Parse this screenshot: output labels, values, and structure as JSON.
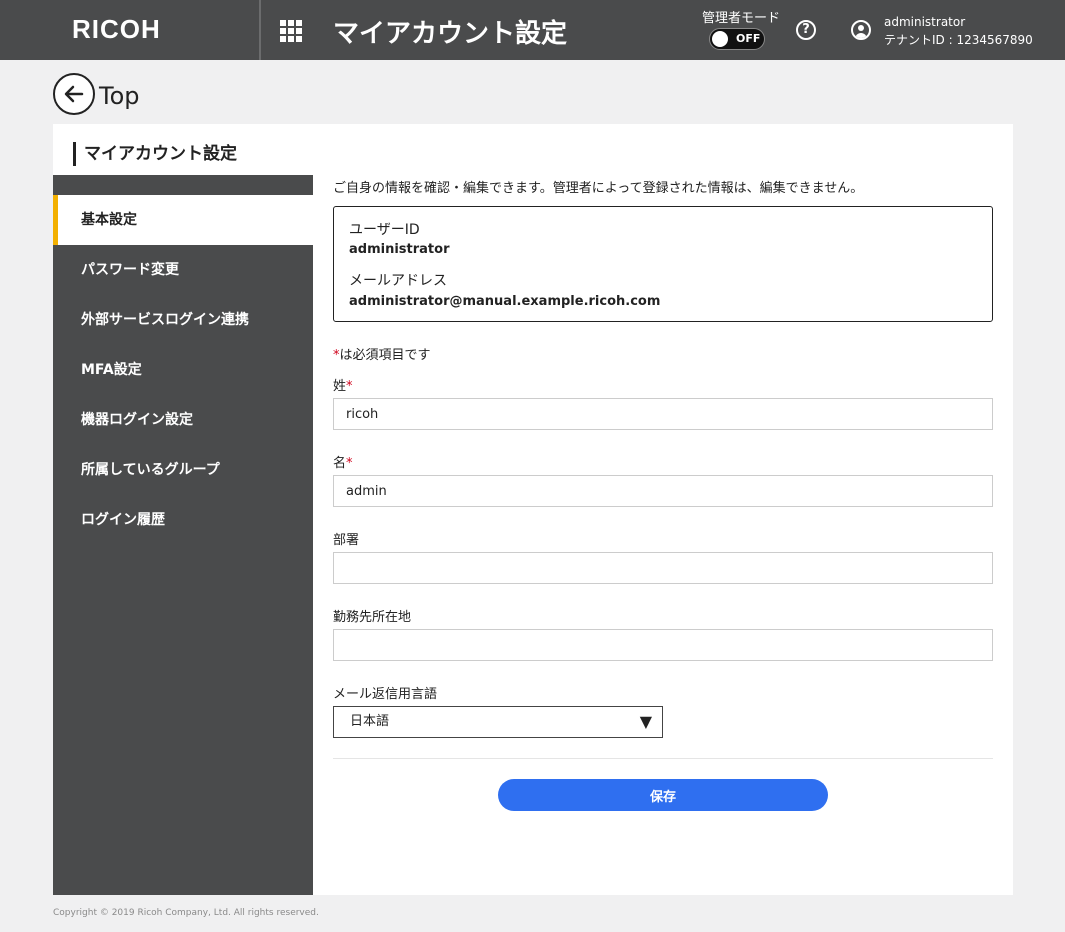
{
  "header": {
    "logo": "RICOH",
    "title": "マイアカウント設定",
    "admin_mode_label": "管理者モード",
    "admin_mode_state": "OFF",
    "help_symbol": "?",
    "user_name": "administrator",
    "tenant_id": "テナントID : 1234567890"
  },
  "nav": {
    "back_label": "Top"
  },
  "panel": {
    "title": "マイアカウント設定",
    "sidebar": {
      "items": [
        {
          "label": "基本設定",
          "active": true
        },
        {
          "label": "パスワード変更"
        },
        {
          "label": "外部サービスログイン連携"
        },
        {
          "label": "MFA設定"
        },
        {
          "label": "機器ログイン設定"
        },
        {
          "label": "所属しているグループ"
        },
        {
          "label": "ログイン履歴"
        }
      ]
    },
    "intro": "ご自身の情報を確認・編集できます。管理者によって登録された情報は、編集できません。",
    "info": {
      "user_id_label": "ユーザーID",
      "user_id_value": "administrator",
      "email_label": "メールアドレス",
      "email_value": "administrator@manual.example.ricoh.com"
    },
    "required_mark": "*",
    "required_note": "は必須項目です",
    "fields": {
      "last_name_label": "姓",
      "last_name_value": "ricoh",
      "first_name_label": "名",
      "first_name_value": "admin",
      "department_label": "部署",
      "department_value": "",
      "work_location_label": "勤務先所在地",
      "work_location_value": "",
      "language_label": "メール返信用言語",
      "language_value": "日本語"
    },
    "save_label": "保存"
  },
  "footer": {
    "copyright": "Copyright © 2019 Ricoh Company, Ltd. All rights reserved."
  },
  "colors": {
    "header_bg": "#4a4b4c",
    "active_accent": "#f3b000",
    "primary_button": "#2f6ff0",
    "required": "#d0021b"
  }
}
